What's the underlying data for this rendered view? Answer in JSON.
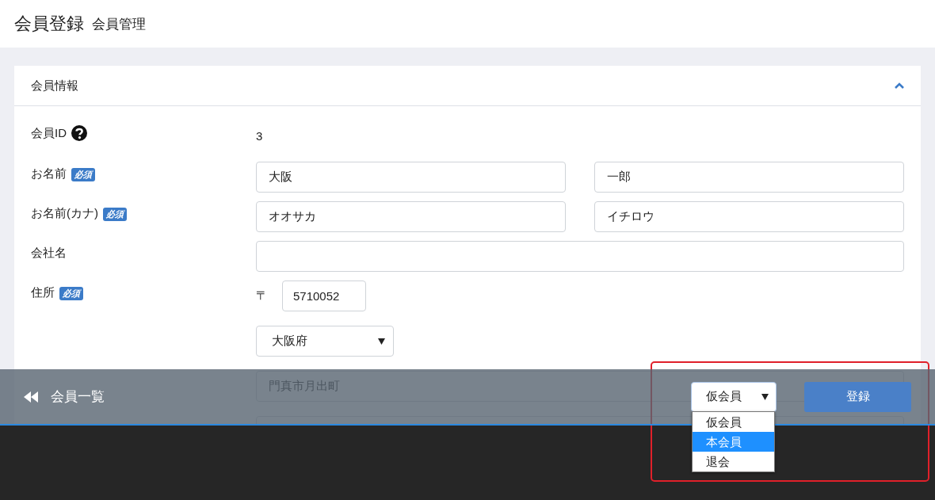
{
  "header": {
    "title": "会員登録",
    "subtitle": "会員管理"
  },
  "card": {
    "title": "会員情報",
    "expanded": true,
    "rows": [
      {
        "kind": "text",
        "label": "会員ID",
        "help": true,
        "value": "3"
      },
      {
        "kind": "pair",
        "label": "お名前",
        "badge": "必須",
        "values": [
          "大阪",
          "一郎"
        ]
      },
      {
        "kind": "pair",
        "label": "お名前(カナ)",
        "badge": "必須",
        "values": [
          "オオサカ",
          "イチロウ"
        ]
      },
      {
        "kind": "single",
        "label": "会社名",
        "value": ""
      },
      {
        "kind": "address",
        "label": "住所",
        "badge": "必須",
        "postal_mark": "〒",
        "postal_code": "5710052",
        "prefecture": "大阪府",
        "city": "門真市月出町"
      }
    ]
  },
  "footer": {
    "back_link": "会員一覧",
    "status_select": {
      "value": "仮会員",
      "open": true,
      "options": [
        {
          "label": "仮会員",
          "highlighted": false
        },
        {
          "label": "本会員",
          "highlighted": true
        },
        {
          "label": "退会",
          "highlighted": false
        }
      ]
    },
    "submit": "登録"
  },
  "highlight_box": true
}
